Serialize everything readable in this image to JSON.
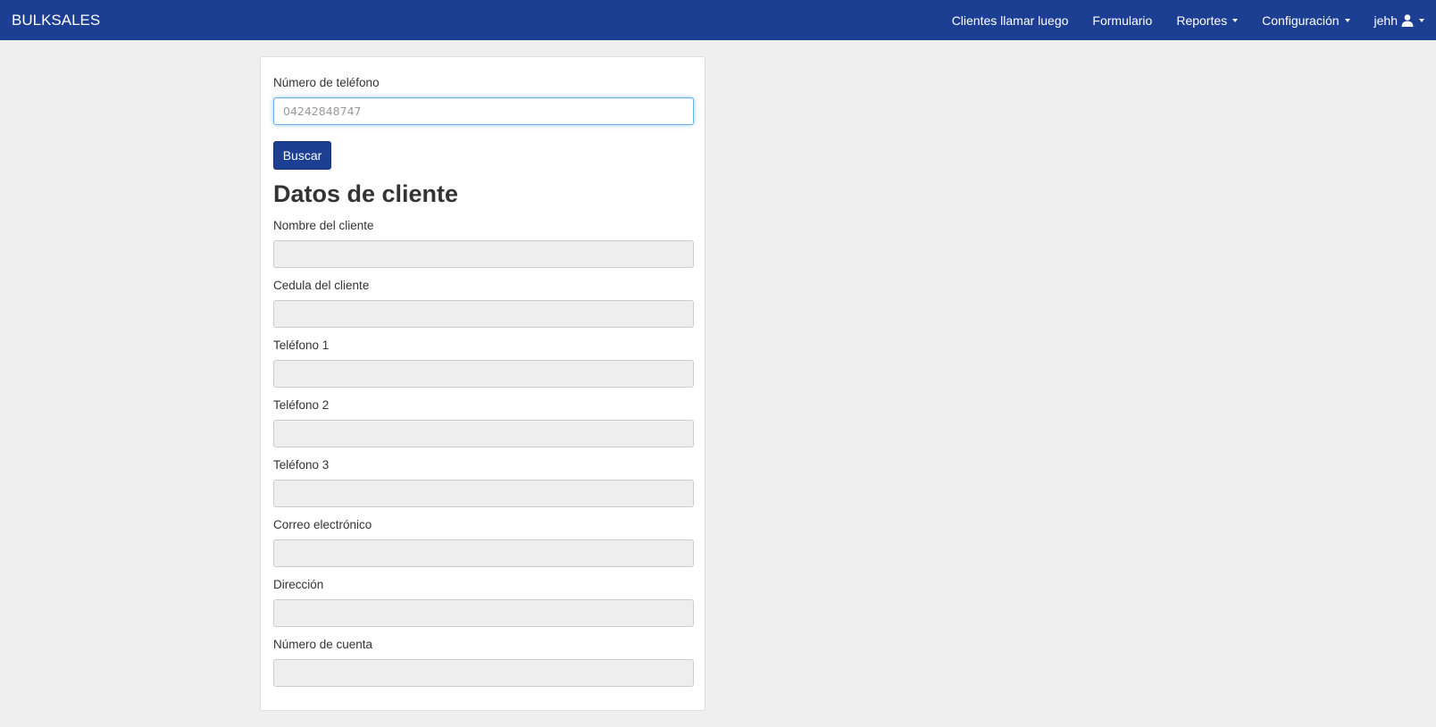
{
  "navbar": {
    "brand": "BULKSALES",
    "items": [
      {
        "label": "Clientes llamar luego"
      },
      {
        "label": "Formulario"
      },
      {
        "label": "Reportes"
      },
      {
        "label": "Configuración"
      },
      {
        "label": "jehh"
      }
    ],
    "color": "#1c3f94"
  },
  "search": {
    "label": "Número de teléfono",
    "placeholder": "04242848747",
    "value": "",
    "button_label": "Buscar"
  },
  "client": {
    "heading": "Datos de cliente",
    "fields": [
      {
        "label": "Nombre del cliente",
        "value": ""
      },
      {
        "label": "Cedula del cliente",
        "value": ""
      },
      {
        "label": "Teléfono 1",
        "value": ""
      },
      {
        "label": "Teléfono 2",
        "value": ""
      },
      {
        "label": "Teléfono 3",
        "value": ""
      },
      {
        "label": "Correo electrónico",
        "value": ""
      },
      {
        "label": "Dirección",
        "value": ""
      },
      {
        "label": "Número de cuenta",
        "value": ""
      }
    ]
  },
  "icons": {
    "user": "user-icon",
    "dropdown": "caret-down-icon"
  }
}
